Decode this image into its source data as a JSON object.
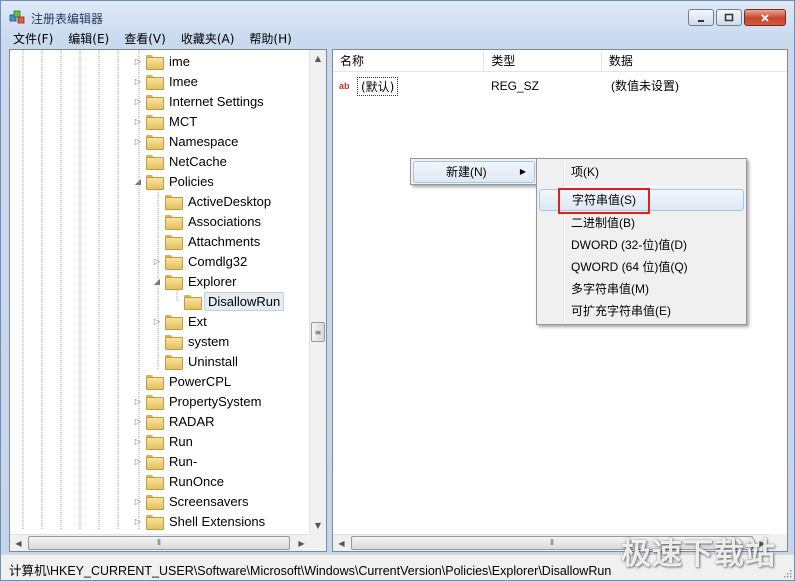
{
  "window": {
    "title": "注册表编辑器"
  },
  "menu": [
    "文件(F)",
    "编辑(E)",
    "查看(V)",
    "收藏夹(A)",
    "帮助(H)"
  ],
  "tree": {
    "items": [
      {
        "label": "ime",
        "level": 0,
        "expander": "collapsed"
      },
      {
        "label": "Imee",
        "level": 0,
        "expander": "collapsed"
      },
      {
        "label": "Internet Settings",
        "level": 0,
        "expander": "collapsed"
      },
      {
        "label": "MCT",
        "level": 0,
        "expander": "collapsed"
      },
      {
        "label": "Namespace",
        "level": 0,
        "expander": "collapsed"
      },
      {
        "label": "NetCache",
        "level": 0,
        "expander": "none"
      },
      {
        "label": "Policies",
        "level": 0,
        "expander": "expanded"
      },
      {
        "label": "ActiveDesktop",
        "level": 1,
        "expander": "none"
      },
      {
        "label": "Associations",
        "level": 1,
        "expander": "none"
      },
      {
        "label": "Attachments",
        "level": 1,
        "expander": "none"
      },
      {
        "label": "Comdlg32",
        "level": 1,
        "expander": "collapsed"
      },
      {
        "label": "Explorer",
        "level": 1,
        "expander": "expanded"
      },
      {
        "label": "DisallowRun",
        "level": 2,
        "expander": "none",
        "selected": true
      },
      {
        "label": "Ext",
        "level": 1,
        "expander": "collapsed"
      },
      {
        "label": "system",
        "level": 1,
        "expander": "none"
      },
      {
        "label": "Uninstall",
        "level": 1,
        "expander": "none"
      },
      {
        "label": "PowerCPL",
        "level": 0,
        "expander": "none"
      },
      {
        "label": "PropertySystem",
        "level": 0,
        "expander": "collapsed"
      },
      {
        "label": "RADAR",
        "level": 0,
        "expander": "collapsed"
      },
      {
        "label": "Run",
        "level": 0,
        "expander": "collapsed"
      },
      {
        "label": "Run-",
        "level": 0,
        "expander": "collapsed"
      },
      {
        "label": "RunOnce",
        "level": 0,
        "expander": "none"
      },
      {
        "label": "Screensavers",
        "level": 0,
        "expander": "collapsed"
      },
      {
        "label": "Shell Extensions",
        "level": 0,
        "expander": "collapsed"
      }
    ]
  },
  "list": {
    "columns": [
      "名称",
      "类型",
      "数据"
    ],
    "rows": [
      {
        "name": "(默认)",
        "type": "REG_SZ",
        "data": "(数值未设置)"
      }
    ]
  },
  "context_menu": {
    "new_label": "新建(N)"
  },
  "submenu": {
    "items": [
      "项(K)",
      "字符串值(S)",
      "二进制值(B)",
      "DWORD (32-位)值(D)",
      "QWORD (64 位)值(Q)",
      "多字符串值(M)",
      "可扩充字符串值(E)"
    ],
    "highlighted": "字符串值(S)"
  },
  "status": {
    "path": "计算机\\HKEY_CURRENT_USER\\Software\\Microsoft\\Windows\\CurrentVersion\\Policies\\Explorer\\DisallowRun"
  },
  "watermark": "极速下载站",
  "colors": {
    "highlight_border": "#e02020",
    "hover_fill": "#dde8f5",
    "folder": "#e6bf5e"
  }
}
